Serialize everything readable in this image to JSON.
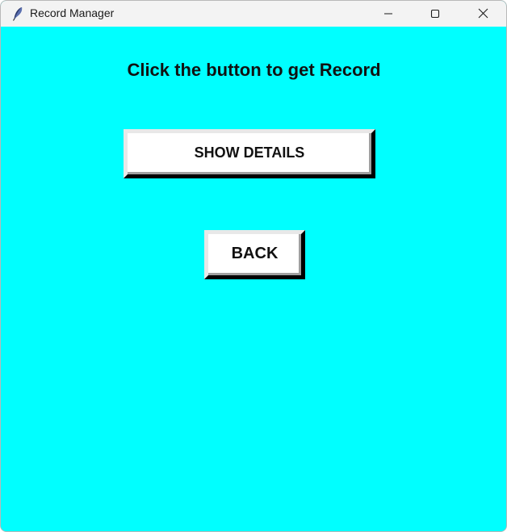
{
  "window": {
    "title": "Record Manager",
    "background": "#00ffff",
    "icons": {
      "app": "feather-icon",
      "minimize": "minimize-icon",
      "maximize": "maximize-icon",
      "close": "close-icon"
    }
  },
  "main": {
    "heading": "Click the button to get Record",
    "show_details_label": "SHOW DETAILS",
    "back_label": "BACK"
  }
}
